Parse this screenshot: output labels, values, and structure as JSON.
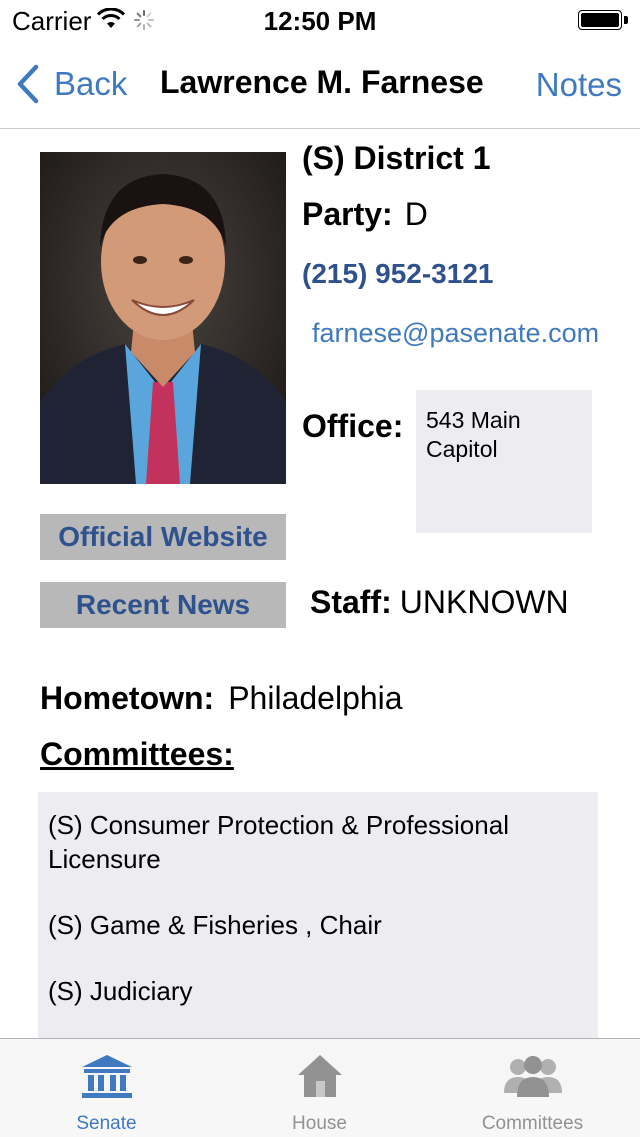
{
  "status_bar": {
    "carrier": "Carrier",
    "time": "12:50 PM"
  },
  "nav": {
    "back_label": "Back",
    "title": "Lawrence M. Farnese",
    "notes_label": "Notes"
  },
  "profile": {
    "district": "(S) District 1",
    "party_label": "Party:",
    "party_value": "D",
    "phone": "(215) 952-3121",
    "email": "farnese@pasenate.com",
    "office_label": "Office:",
    "office_value_line1": "543 Main",
    "office_value_line2": "Capitol",
    "official_website_label": "Official Website",
    "recent_news_label": "Recent News",
    "staff_label": "Staff:",
    "staff_value": "UNKNOWN",
    "hometown_label": "Hometown:",
    "hometown_value": "Philadelphia",
    "committees_label": "Committees:",
    "committees": [
      "(S) Consumer Protection & Professional Licensure",
      "(S) Game & Fisheries , Chair",
      "(S) Judiciary"
    ]
  },
  "tabs": [
    {
      "label": "Senate",
      "icon": "senate-building-icon",
      "active": true
    },
    {
      "label": "House",
      "icon": "house-icon",
      "active": false
    },
    {
      "label": "Committees",
      "icon": "committees-people-icon",
      "active": false
    }
  ],
  "colors": {
    "accent": "#3f7ac1",
    "link_dark": "#2f528f",
    "button_gray": "#b8b8b8",
    "box_gray": "#ececf1"
  }
}
